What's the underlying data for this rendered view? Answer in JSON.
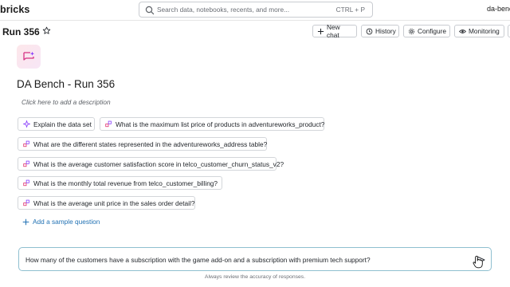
{
  "app": {
    "brand": "bricks",
    "user": "da-benc"
  },
  "search": {
    "placeholder": "Search data, notebooks, recents, and more...",
    "shortcut": "CTRL + P"
  },
  "header": {
    "title": "Run 356",
    "actions": {
      "new_chat": "New chat",
      "history": "History",
      "configure": "Configure",
      "monitoring": "Monitoring"
    }
  },
  "space": {
    "title": "DA Bench - Run 356",
    "description_placeholder": "Click here to add a description"
  },
  "sample_questions": [
    {
      "label": "Explain the data set",
      "icon": "sparkle-icon"
    },
    {
      "label": "What is the maximum list price of products in adventureworks_product?",
      "icon": "sample-question-icon"
    },
    {
      "label": "What are the different states represented in the adventureworks_address table?",
      "icon": "sample-question-icon"
    },
    {
      "label": "What is the average customer satisfaction score in telco_customer_churn_status_v2?",
      "icon": "sample-question-icon"
    },
    {
      "label": "What is the monthly total revenue from telco_customer_billing?",
      "icon": "sample-question-icon"
    },
    {
      "label": "What is the average unit price in the sales order detail?",
      "icon": "sample-question-icon"
    }
  ],
  "add_sample_label": "Add a sample question",
  "composer": {
    "value": "How many of the customers have a subscription with the game add-on and a subscription with premium tech support?",
    "send_icon": "send-icon"
  },
  "footer_note": "Always review the accuracy of responses.",
  "colors": {
    "link": "#2272b4",
    "accent_pink": "#e0316e",
    "accent_purple": "#8a3ffc",
    "border": "#c9ccd1"
  }
}
